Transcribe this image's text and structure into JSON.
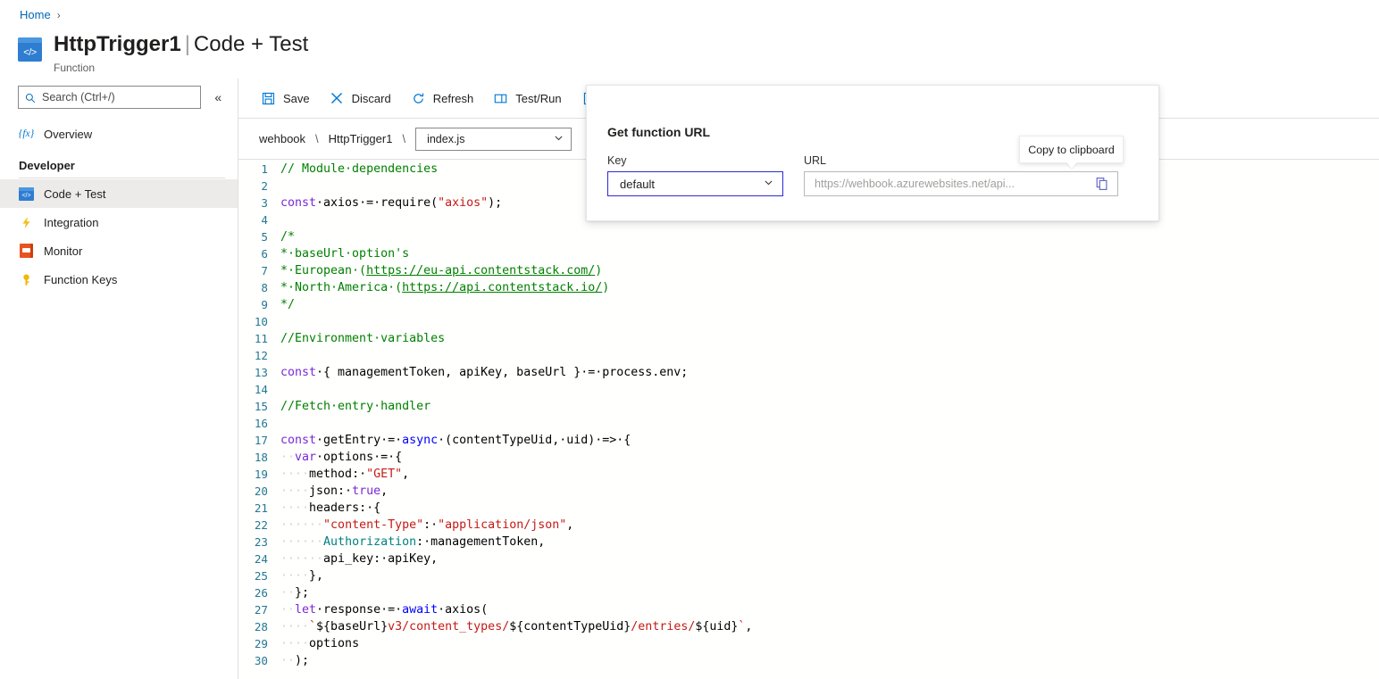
{
  "breadcrumb": {
    "home": "Home",
    "separator": "›"
  },
  "header": {
    "title_name": "HttpTrigger1",
    "title_divider": "|",
    "title_page": "Code + Test",
    "subtitle": "Function",
    "icon": "code-resource-icon"
  },
  "sidebar": {
    "search": {
      "placeholder": "Search (Ctrl+/)",
      "icon": "search-icon"
    },
    "collapse": {
      "icon": "double-chevron-left-icon",
      "glyph": "«"
    },
    "items": [
      {
        "label": "Overview",
        "icon": "function-fx-icon",
        "selected": false
      }
    ],
    "group_label": "Developer",
    "developer_items": [
      {
        "label": "Code + Test",
        "icon": "code-icon",
        "selected": true
      },
      {
        "label": "Integration",
        "icon": "lightning-bolt-icon",
        "selected": false
      },
      {
        "label": "Monitor",
        "icon": "monitor-icon",
        "selected": false
      },
      {
        "label": "Function Keys",
        "icon": "key-icon",
        "selected": false
      }
    ]
  },
  "toolbar": {
    "buttons": [
      {
        "label": "Save",
        "icon": "save-disk-icon"
      },
      {
        "label": "Discard",
        "icon": "close-x-icon"
      },
      {
        "label": "Refresh",
        "icon": "refresh-circle-icon"
      },
      {
        "label": "Test/Run",
        "icon": "test-run-panel-icon"
      },
      {
        "label": "",
        "icon": "get-function-url-icon"
      }
    ]
  },
  "filebar": {
    "app_name": "wehbook",
    "sep1": "\\",
    "function_name": "HttpTrigger1",
    "sep2": "\\",
    "file_select": {
      "value": "index.js",
      "chevron": "⌄"
    }
  },
  "popup": {
    "title": "Get function URL",
    "key_label": "Key",
    "key_value": "default",
    "key_chevron": "⌄",
    "url_label": "URL",
    "url_placeholder": "https://wehbook.azurewebsites.net/api...",
    "copy_icon": "copy-to-clipboard-icon",
    "tooltip": "Copy to clipboard"
  },
  "colors": {
    "accent": "#0078d4",
    "link": "#0067b8",
    "selected_nav": "#edebe9",
    "comment": "#008000",
    "keyword": "#7b29d6",
    "string": "#c41a16",
    "property": "#008080",
    "line_number": "#237893",
    "focus_border": "#2b2bd4"
  },
  "editor": {
    "language": "javascript",
    "first_line": 1,
    "last_visible_line": 30,
    "lines": [
      {
        "n": 1,
        "tokens": [
          {
            "t": "// Module·dependencies",
            "c": "t-com"
          }
        ]
      },
      {
        "n": 2,
        "tokens": []
      },
      {
        "n": 3,
        "tokens": [
          {
            "t": "const",
            "c": "t-kw"
          },
          {
            "t": "·axios·=·require(",
            "c": ""
          },
          {
            "t": "\"axios\"",
            "c": "t-str"
          },
          {
            "t": ");",
            "c": ""
          }
        ]
      },
      {
        "n": 4,
        "tokens": []
      },
      {
        "n": 5,
        "tokens": [
          {
            "t": "/*",
            "c": "t-com"
          }
        ]
      },
      {
        "n": 6,
        "tokens": [
          {
            "t": "*·baseUrl·option's",
            "c": "t-com"
          }
        ]
      },
      {
        "n": 7,
        "tokens": [
          {
            "t": "*·European·(",
            "c": "t-com"
          },
          {
            "t": "https://eu-api.contentstack.com/",
            "c": "t-url"
          },
          {
            "t": ")",
            "c": "t-com"
          }
        ]
      },
      {
        "n": 8,
        "tokens": [
          {
            "t": "*·North·America·(",
            "c": "t-com"
          },
          {
            "t": "https://api.contentstack.io/",
            "c": "t-url"
          },
          {
            "t": ")",
            "c": "t-com"
          }
        ]
      },
      {
        "n": 9,
        "tokens": [
          {
            "t": "*/",
            "c": "t-com"
          }
        ]
      },
      {
        "n": 10,
        "tokens": []
      },
      {
        "n": 11,
        "tokens": [
          {
            "t": "//Environment·variables",
            "c": "t-com"
          }
        ]
      },
      {
        "n": 12,
        "tokens": []
      },
      {
        "n": 13,
        "tokens": [
          {
            "t": "const",
            "c": "t-kw"
          },
          {
            "t": "·{ managementToken, apiKey, baseUrl }·=·process.env;",
            "c": ""
          }
        ]
      },
      {
        "n": 14,
        "tokens": []
      },
      {
        "n": 15,
        "tokens": [
          {
            "t": "//Fetch·entry·handler",
            "c": "t-com"
          }
        ]
      },
      {
        "n": 16,
        "tokens": []
      },
      {
        "n": 17,
        "tokens": [
          {
            "t": "const",
            "c": "t-kw"
          },
          {
            "t": "·getEntry·=·",
            "c": ""
          },
          {
            "t": "async",
            "c": "t-kw2"
          },
          {
            "t": "·(contentTypeUid,·uid)·=>·{",
            "c": ""
          }
        ]
      },
      {
        "n": 18,
        "tokens": [
          {
            "t": "··",
            "c": "ws"
          },
          {
            "t": "var",
            "c": "t-kw"
          },
          {
            "t": "·options·=·{",
            "c": ""
          }
        ]
      },
      {
        "n": 19,
        "tokens": [
          {
            "t": "····",
            "c": "ws"
          },
          {
            "t": "method:·",
            "c": ""
          },
          {
            "t": "\"GET\"",
            "c": "t-str"
          },
          {
            "t": ",",
            "c": ""
          }
        ]
      },
      {
        "n": 20,
        "tokens": [
          {
            "t": "····",
            "c": "ws"
          },
          {
            "t": "json:·",
            "c": ""
          },
          {
            "t": "true",
            "c": "t-kw"
          },
          {
            "t": ",",
            "c": ""
          }
        ]
      },
      {
        "n": 21,
        "tokens": [
          {
            "t": "····",
            "c": "ws"
          },
          {
            "t": "headers:·{",
            "c": ""
          }
        ]
      },
      {
        "n": 22,
        "tokens": [
          {
            "t": "······",
            "c": "ws"
          },
          {
            "t": "\"content-Type\"",
            "c": "t-str"
          },
          {
            "t": ":·",
            "c": ""
          },
          {
            "t": "\"application/json\"",
            "c": "t-str"
          },
          {
            "t": ",",
            "c": ""
          }
        ]
      },
      {
        "n": 23,
        "tokens": [
          {
            "t": "······",
            "c": "ws"
          },
          {
            "t": "Authorization",
            "c": "t-prop"
          },
          {
            "t": ":·managementToken,",
            "c": ""
          }
        ]
      },
      {
        "n": 24,
        "tokens": [
          {
            "t": "······",
            "c": "ws"
          },
          {
            "t": "api_key:·apiKey,",
            "c": ""
          }
        ]
      },
      {
        "n": 25,
        "tokens": [
          {
            "t": "····",
            "c": "ws"
          },
          {
            "t": "},",
            "c": ""
          }
        ]
      },
      {
        "n": 26,
        "tokens": [
          {
            "t": "··",
            "c": "ws"
          },
          {
            "t": "};",
            "c": ""
          }
        ]
      },
      {
        "n": 27,
        "tokens": [
          {
            "t": "··",
            "c": "ws"
          },
          {
            "t": "let",
            "c": "t-kw"
          },
          {
            "t": "·response·=·",
            "c": ""
          },
          {
            "t": "await",
            "c": "t-kw2"
          },
          {
            "t": "·axios(",
            "c": ""
          }
        ]
      },
      {
        "n": 28,
        "tokens": [
          {
            "t": "····",
            "c": "ws"
          },
          {
            "t": "`",
            "c": "t-str"
          },
          {
            "t": "${baseUrl}",
            "c": ""
          },
          {
            "t": "v3/content_types/",
            "c": "t-str"
          },
          {
            "t": "${contentTypeUid}",
            "c": ""
          },
          {
            "t": "/entries/",
            "c": "t-str"
          },
          {
            "t": "${uid}",
            "c": ""
          },
          {
            "t": "`",
            "c": "t-str"
          },
          {
            "t": ",",
            "c": ""
          }
        ]
      },
      {
        "n": 29,
        "tokens": [
          {
            "t": "····",
            "c": "ws"
          },
          {
            "t": "options",
            "c": ""
          }
        ]
      },
      {
        "n": 30,
        "tokens": [
          {
            "t": "··",
            "c": "ws"
          },
          {
            "t": ");",
            "c": ""
          }
        ]
      }
    ]
  }
}
